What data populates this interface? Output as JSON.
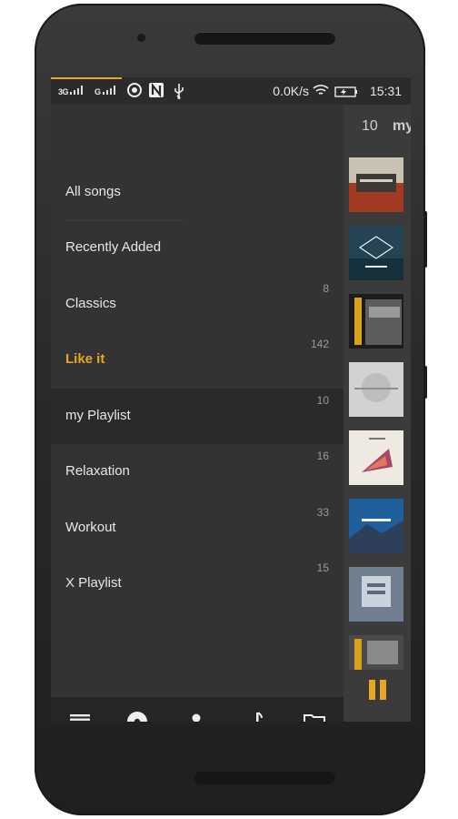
{
  "status_bar": {
    "signal_1": "3G",
    "signal_2": "G",
    "icons": [
      "sync-icon",
      "n-icon",
      "usb-icon"
    ],
    "net_speed": "0.0K/s",
    "time": "15:31"
  },
  "drawer": {
    "items": [
      {
        "label": "All songs",
        "count": ""
      },
      {
        "label": "Recently Added",
        "count": ""
      },
      {
        "label": "Classics",
        "count": "8"
      },
      {
        "label": "Like it",
        "count": "142"
      },
      {
        "label": "my Playlist",
        "count": "10"
      },
      {
        "label": "Relaxation",
        "count": "16"
      },
      {
        "label": "Workout",
        "count": "33"
      },
      {
        "label": "X Playlist",
        "count": "15"
      }
    ],
    "active_index": 4,
    "highlight_index": 3
  },
  "bottom_nav": {
    "items": [
      "playlist-icon",
      "album-icon",
      "artist-icon",
      "song-icon",
      "folder-icon"
    ],
    "selected": "playlist-icon"
  },
  "playlist_pane": {
    "count": "10",
    "title": "my",
    "play_state_icon": "pause-icon"
  },
  "colors": {
    "accent": "#e8a623",
    "drawer_bg": "#333334",
    "active_row_bg": "#2a2a2b",
    "text": "#e7e7e7",
    "count_text": "#9a9a9a"
  }
}
